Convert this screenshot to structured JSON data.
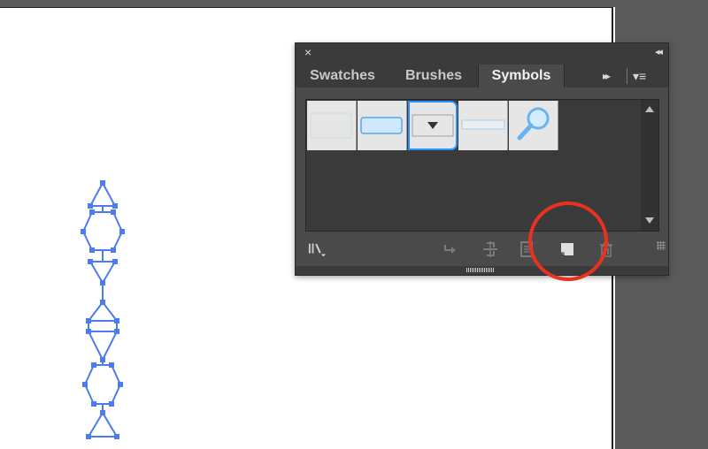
{
  "panel": {
    "close_glyph": "×",
    "collapse_glyph": "◂◂",
    "tabs": [
      {
        "label": "Swatches"
      },
      {
        "label": "Brushes"
      },
      {
        "label": "Symbols"
      }
    ],
    "active_tab": "Symbols",
    "overflow_glyph": "▸▸",
    "menu_glyph": "▾≡"
  },
  "symbols": [
    {
      "name": "empty-rectangle-symbol"
    },
    {
      "name": "blue-button-symbol"
    },
    {
      "name": "dropdown-arrow-symbol"
    },
    {
      "name": "thin-bar-symbol"
    },
    {
      "name": "magnifier-symbol"
    }
  ],
  "toolbar_icons": [
    "symbol-libraries-menu-icon",
    "place-symbol-instance-icon",
    "break-link-to-symbol-icon",
    "symbol-options-icon",
    "new-symbol-icon",
    "delete-symbol-icon"
  ],
  "colors": {
    "panel_bg": "#4a4a4a",
    "selection_blue": "#2b90ff",
    "artwork_blue": "#4d7cf0",
    "highlight_red": "#e8321f"
  }
}
